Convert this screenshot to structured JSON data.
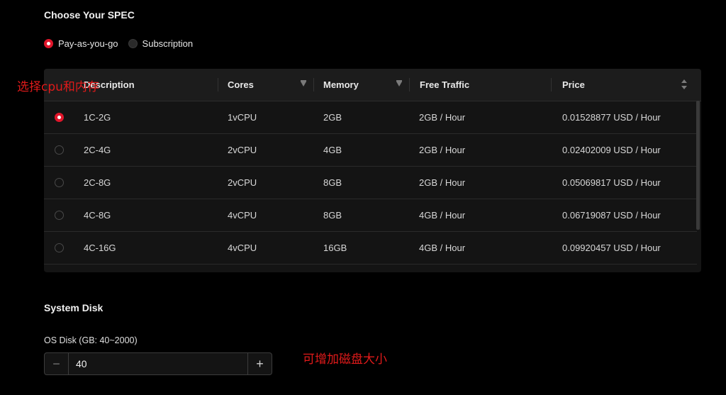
{
  "spec": {
    "title": "Choose Your SPEC",
    "billing": [
      {
        "label": "Pay-as-you-go",
        "selected": true
      },
      {
        "label": "Subscription",
        "selected": false
      }
    ]
  },
  "table": {
    "columns": [
      "Description",
      "Cores",
      "Memory",
      "Free Traffic",
      "Price"
    ],
    "rows": [
      {
        "description": "1C-2G",
        "cores": "1vCPU",
        "memory": "2GB",
        "traffic": "2GB / Hour",
        "price": "0.01528877 USD / Hour",
        "selected": true
      },
      {
        "description": "2C-4G",
        "cores": "2vCPU",
        "memory": "4GB",
        "traffic": "2GB / Hour",
        "price": "0.02402009 USD / Hour",
        "selected": false
      },
      {
        "description": "2C-8G",
        "cores": "2vCPU",
        "memory": "8GB",
        "traffic": "2GB / Hour",
        "price": "0.05069817 USD / Hour",
        "selected": false
      },
      {
        "description": "4C-8G",
        "cores": "4vCPU",
        "memory": "8GB",
        "traffic": "4GB / Hour",
        "price": "0.06719087 USD / Hour",
        "selected": false
      },
      {
        "description": "4C-16G",
        "cores": "4vCPU",
        "memory": "16GB",
        "traffic": "4GB / Hour",
        "price": "0.09920457 USD / Hour",
        "selected": false
      }
    ]
  },
  "disk": {
    "title": "System Disk",
    "label": "OS Disk (GB: 40~2000)",
    "value": "40",
    "minus": "−",
    "plus": "+"
  },
  "annotations": {
    "select": "选择cpu和内存",
    "disk": "可增加磁盘大小"
  },
  "colors": {
    "accent": "#e0162b",
    "annotation": "#e01a1a"
  },
  "icons": [
    "filter-icon",
    "sort-icon",
    "radio-icon",
    "minus-icon",
    "plus-icon"
  ]
}
